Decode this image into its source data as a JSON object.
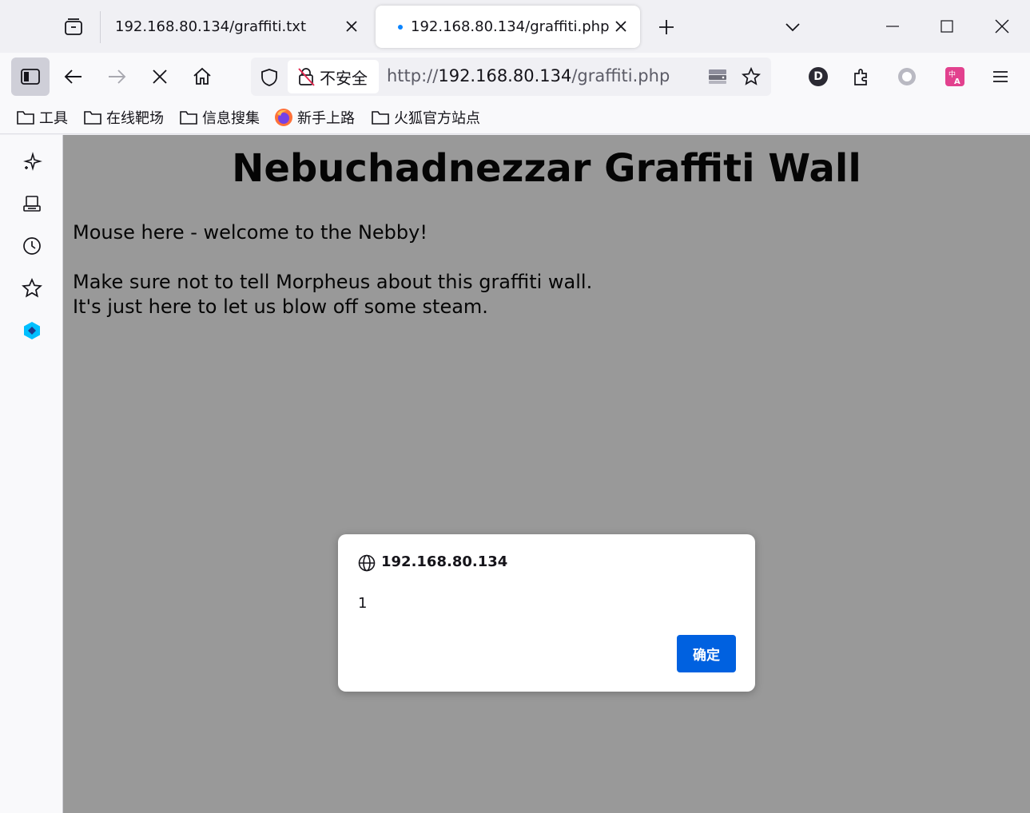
{
  "tabs": [
    {
      "title": "192.168.80.134/graffiti.txt",
      "active": false
    },
    {
      "title": "192.168.80.134/graffiti.php",
      "active": true
    }
  ],
  "urlbar": {
    "security_label": "不安全",
    "url_scheme": "http://",
    "url_host": "192.168.80.134",
    "url_path": "/graffiti.php"
  },
  "toolbar": {
    "account_initial": "D"
  },
  "bookmarks": [
    "工具",
    "在线靶场",
    "信息搜集",
    "新手上路",
    "火狐官方站点"
  ],
  "page": {
    "heading": "Nebuchadnezzar Graffiti Wall",
    "lines": [
      "Mouse here - welcome to the Nebby!",
      "Make sure not to tell Morpheus about this graffiti wall.",
      "It's just here to let us blow off some steam."
    ]
  },
  "dialog": {
    "origin": "192.168.80.134",
    "message": "1",
    "ok_label": "确定"
  },
  "colors": {
    "accent": "#0061e0",
    "tab_loading_dot": "#0a84ff",
    "translate_icon": "#e2418e",
    "sidebar_app_icon": "#00bfff"
  }
}
